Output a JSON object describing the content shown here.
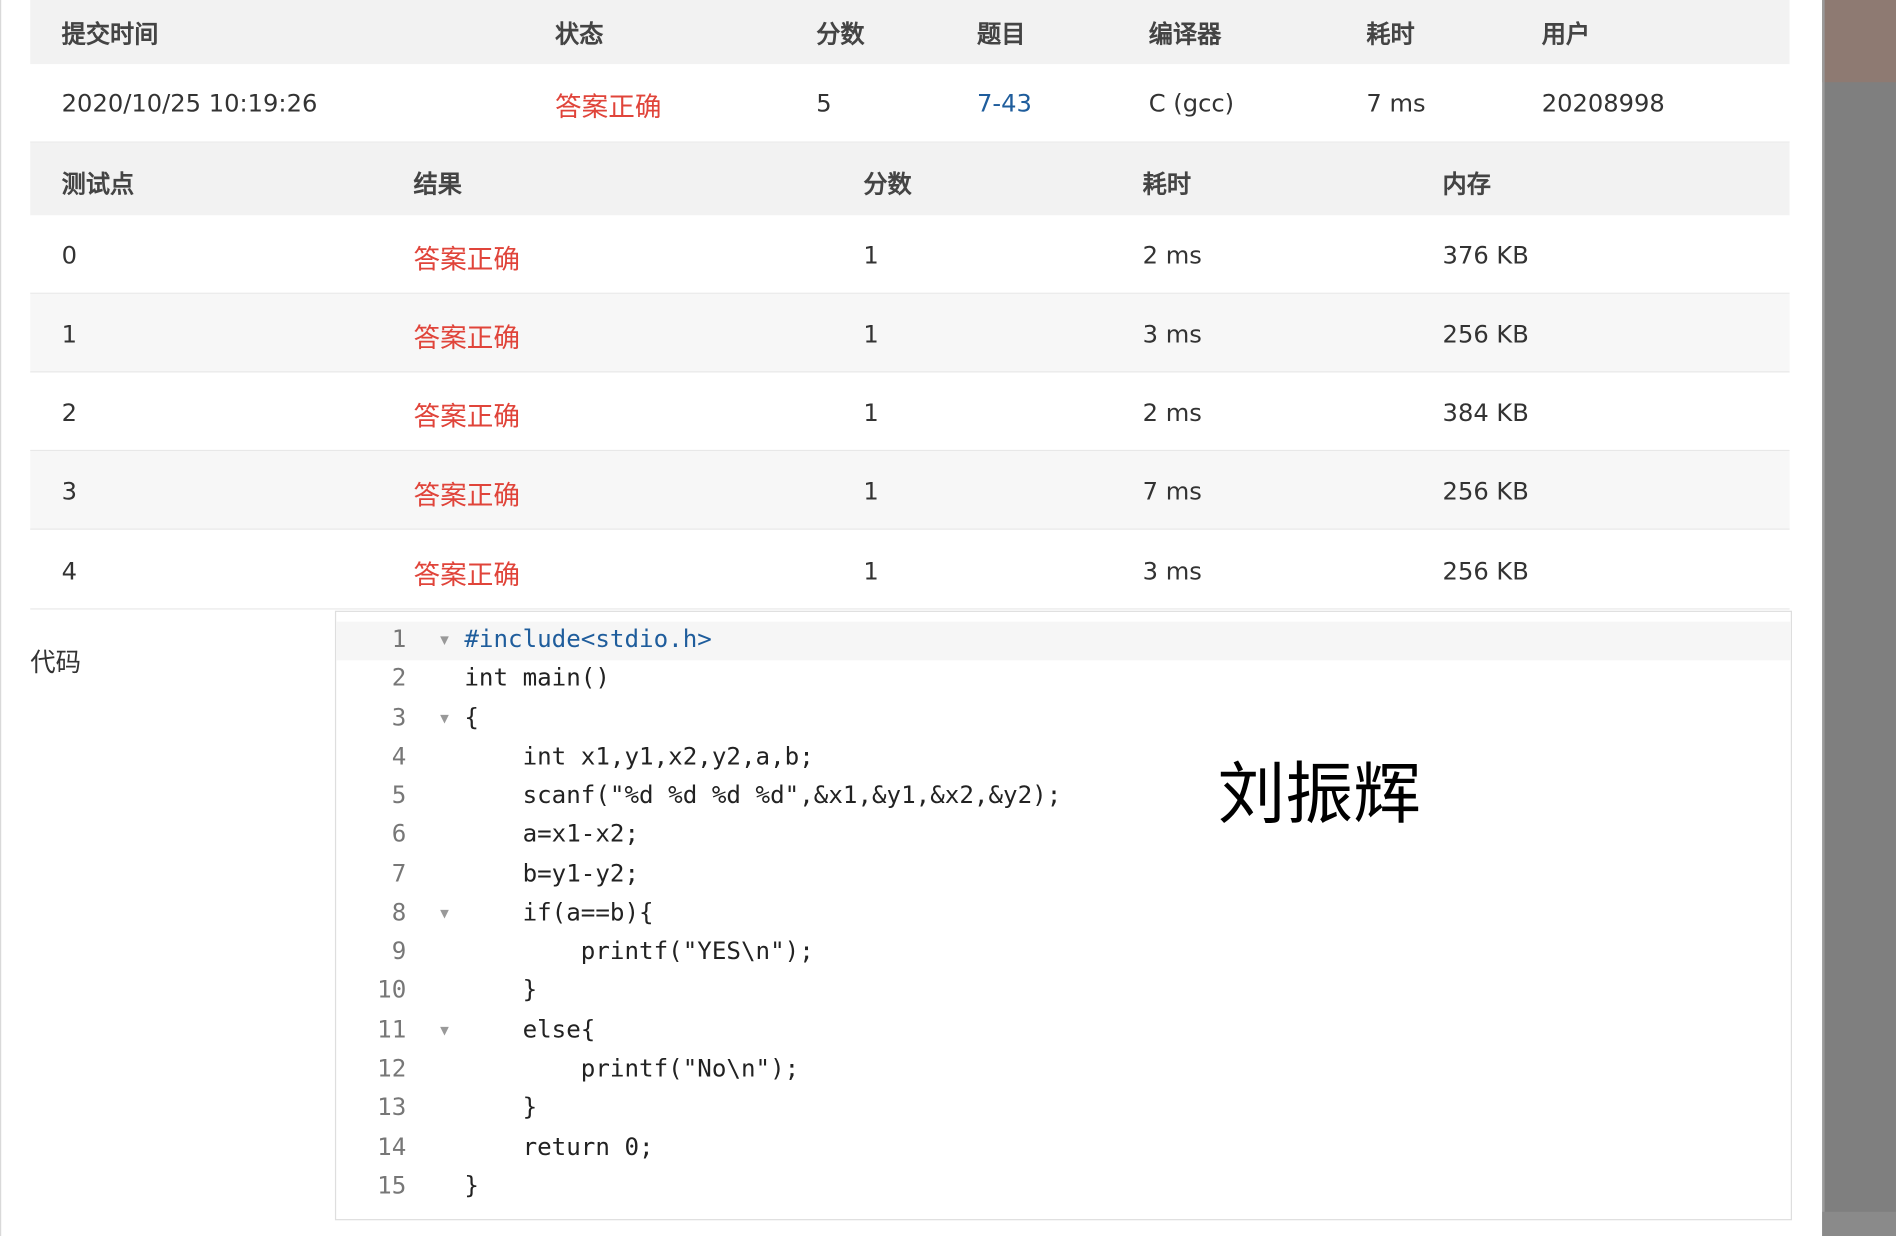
{
  "submission": {
    "headers": [
      "提交时间",
      "状态",
      "分数",
      "题目",
      "编译器",
      "耗时",
      "用户"
    ],
    "row": {
      "time": "2020/10/25 10:19:26",
      "status": "答案正确",
      "score": "5",
      "problem": "7-43",
      "compiler": "C (gcc)",
      "duration": "7 ms",
      "user": "20208998"
    }
  },
  "testcases": {
    "headers": [
      "测试点",
      "结果",
      "分数",
      "耗时",
      "内存"
    ],
    "rows": [
      {
        "id": "0",
        "result": "答案正确",
        "score": "1",
        "time": "2 ms",
        "memory": "376 KB"
      },
      {
        "id": "1",
        "result": "答案正确",
        "score": "1",
        "time": "3 ms",
        "memory": "256 KB"
      },
      {
        "id": "2",
        "result": "答案正确",
        "score": "1",
        "time": "2 ms",
        "memory": "384 KB"
      },
      {
        "id": "3",
        "result": "答案正确",
        "score": "1",
        "time": "7 ms",
        "memory": "256 KB"
      },
      {
        "id": "4",
        "result": "答案正确",
        "score": "1",
        "time": "3 ms",
        "memory": "256 KB"
      }
    ]
  },
  "code": {
    "label": "代码",
    "lines": [
      "#include<stdio.h>",
      "int main()",
      "{",
      "    int x1,y1,x2,y2,a,b;",
      "    scanf(\"%d %d %d %d\",&x1,&y1,&x2,&y2);",
      "    a=x1-x2;",
      "    b=y1-y2;",
      "    if(a==b){",
      "        printf(\"YES\\n\");",
      "    }",
      "    else{",
      "        printf(\"No\\n\");",
      "    }",
      "    return 0;",
      "}"
    ],
    "line_numbers": [
      "1",
      "2",
      "3",
      "4",
      "5",
      "6",
      "7",
      "8",
      "9",
      "10",
      "11",
      "12",
      "13",
      "14",
      "15"
    ],
    "fold_markers": [
      "1",
      "3",
      "8",
      "11"
    ]
  },
  "watermark": "刘振辉",
  "colors": {
    "accepted": "#e0443a",
    "link": "#1f5d9c",
    "header_bg": "#f2f2f2",
    "side_panel": "#7f7f7f"
  }
}
